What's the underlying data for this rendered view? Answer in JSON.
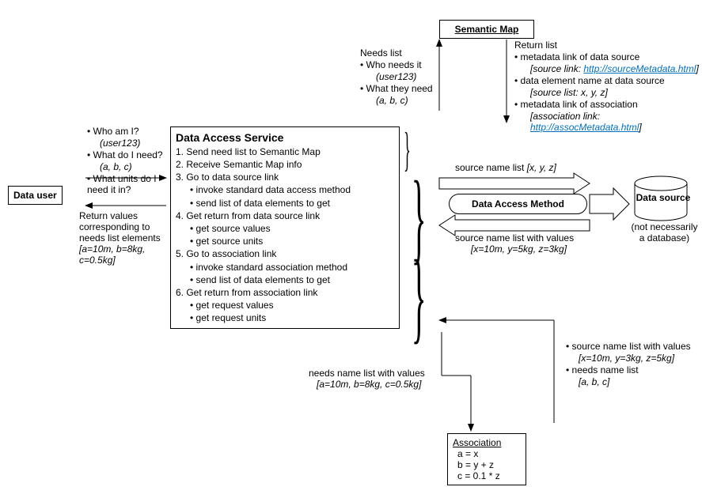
{
  "semanticMap": {
    "title": "Semantic Map"
  },
  "needsList": {
    "heading": "Needs list",
    "who": "Who needs it",
    "whoVal": "(user123)",
    "what": "What they need",
    "whatVal": "(a, b, c)"
  },
  "returnList": {
    "heading": "Return list",
    "item1": "metadata link of data source",
    "item1val": "[source link: ",
    "item1link": "http://sourceMetadata.html",
    "item2": "data element name at data source",
    "item2val": "[source list: x, y, z]",
    "item3": "metadata link of association",
    "item3val": "[association link: ",
    "item3link": "http://assocMetadata.html"
  },
  "userQuestions": {
    "q1": "Who am I?",
    "q1val": "(user123)",
    "q2": "What do I need?",
    "q2val": "(a, b, c)",
    "q3": "What units do I need it in?"
  },
  "dataUser": {
    "label": "Data user"
  },
  "returnValues": {
    "l1": "Return values",
    "l2": "corresponding to",
    "l3": "needs list elements",
    "l4": "[a=10m, b=8kg, c=0.5kg]"
  },
  "das": {
    "title": "Data Access Service",
    "s1": "1. Send need list to Semantic Map",
    "s2": "2. Receive Semantic Map info",
    "s3": "3. Go to data source link",
    "s3a": "invoke standard data access method",
    "s3b": "send list of data elements to get",
    "s4": "4. Get return from data source link",
    "s4a": "get source values",
    "s4b": "get source units",
    "s5": "5. Go to association link",
    "s5a": "invoke standard association method",
    "s5b": "send list of data elements to get",
    "s6": "6. Get return from association link",
    "s6a": "get request values",
    "s6b": "get request units"
  },
  "sourceNameList": {
    "top": "source name list",
    "topVal": "[x, y, z]",
    "bottom": "source name list with values",
    "bottomVal": "[x=10m, y=5kg, z=3kg]"
  },
  "dam": {
    "label": "Data Access Method"
  },
  "dataSource": {
    "label": "Data source",
    "sub1": "(not necessarily",
    "sub2": "a database)"
  },
  "bottomRight": {
    "item1": "source name list with values",
    "item1val": "[x=10m, y=3kg, z=5kg]",
    "item2": "needs name list",
    "item2val": "[a, b, c]"
  },
  "bottomLeft": {
    "l1": "needs name list with values",
    "l2": "[a=10m, b=8kg, c=0.5kg]"
  },
  "association": {
    "title": "Association",
    "e1": "a = x",
    "e2": "b = y + z",
    "e3": "c = 0.1 * z"
  }
}
